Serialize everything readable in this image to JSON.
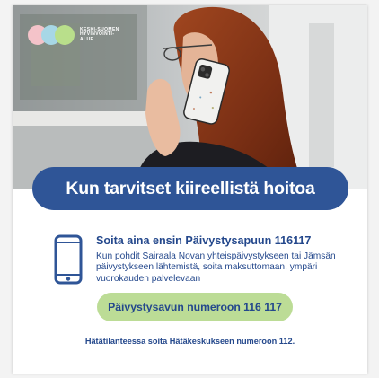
{
  "logo": {
    "text": "KESKI-SUOMEN HYVINVOINTI-ALUE",
    "dot_colors": [
      "#f4c3c9",
      "#a7d7e6",
      "#b9df8b"
    ]
  },
  "banner": {
    "text": "Kun tarvitset kiireellistä hoitoa"
  },
  "info": {
    "icon": "mobile-phone-icon",
    "title": "Soita aina ensin Päivystysapuun 116117",
    "body": "Kun pohdit Sairaala Novan yhteispäivystykseen tai Jämsän päivystykseen lähtemistä, soita maksuttomaan, ympäri vuorokauden palvelevaan"
  },
  "cta": {
    "label": "Päivystysavun numeroon 116 117"
  },
  "emergency": {
    "text": "Hätätilanteessa soita Hätäkeskukseen numeroon 112."
  },
  "colors": {
    "primary": "#2f5597",
    "text": "#24488c",
    "cta_bg": "#bcdc96",
    "page_bg": "#ffffff"
  }
}
